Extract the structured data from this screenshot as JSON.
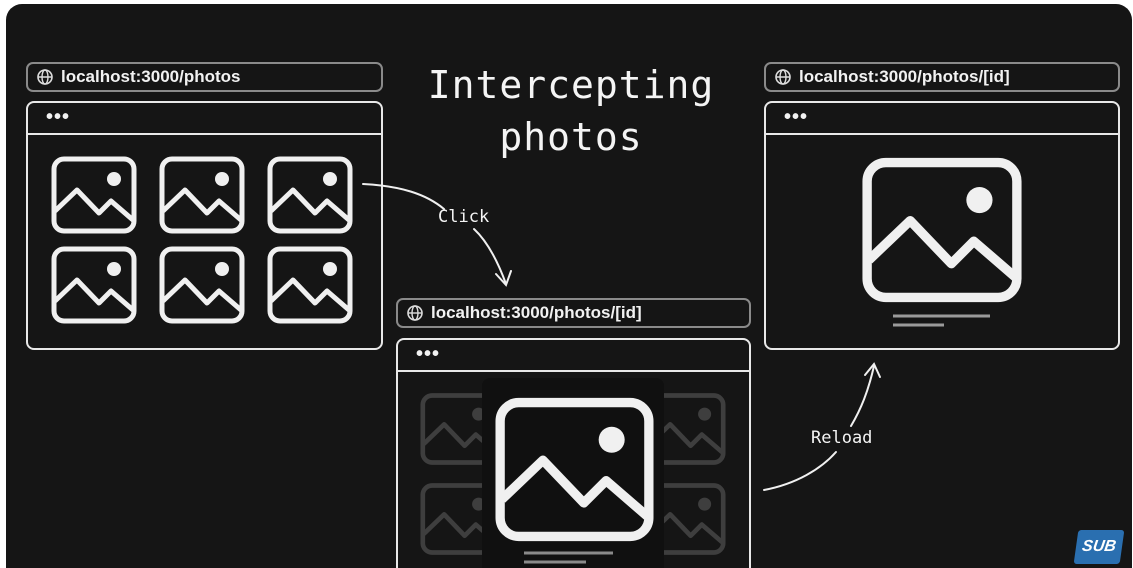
{
  "title_line1": "Intercepting",
  "title_line2": "photos",
  "left_url": "localhost:3000/photos",
  "middle_url": "localhost:3000/photos/[id]",
  "right_url": "localhost:3000/photos/[id]",
  "window_dots": "•••",
  "click_label": "Click",
  "reload_label": "Reload",
  "badge": "SUB",
  "icons": [
    "globe-icon",
    "image-icon"
  ]
}
